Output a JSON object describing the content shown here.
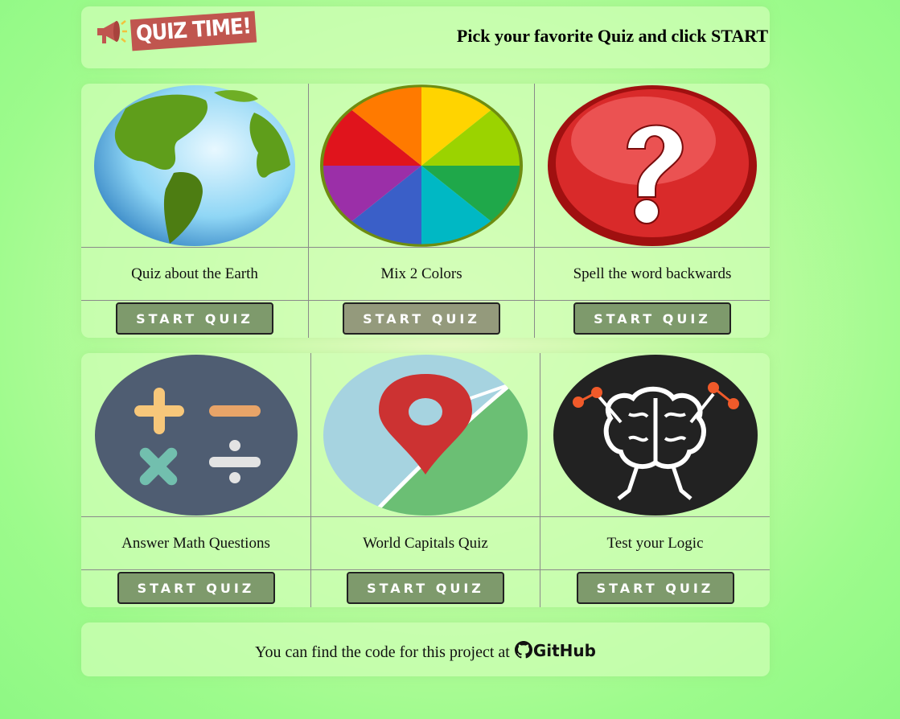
{
  "header": {
    "logo_text": "QUIZ TIME!",
    "tagline": "Pick your favorite Quiz and click START"
  },
  "quizzes": [
    {
      "title": "Quiz about the Earth",
      "button": "START QUIZ",
      "icon": "globe-icon"
    },
    {
      "title": "Mix 2 Colors",
      "button": "START QUIZ",
      "icon": "color-wheel-icon"
    },
    {
      "title": "Spell the word backwards",
      "button": "START QUIZ",
      "icon": "question-mark-icon"
    },
    {
      "title": "Answer Math Questions",
      "button": "START QUIZ",
      "icon": "math-operators-icon"
    },
    {
      "title": "World Capitals Quiz",
      "button": "START QUIZ",
      "icon": "map-pin-icon"
    },
    {
      "title": "Test your Logic",
      "button": "START QUIZ",
      "icon": "brain-icon"
    }
  ],
  "footer": {
    "text": "You can find the code for this project at",
    "link_label": "GitHub"
  },
  "colors": {
    "background": "#8ef884",
    "button": "#7e9a6c",
    "logo_badge": "#c0564f"
  }
}
